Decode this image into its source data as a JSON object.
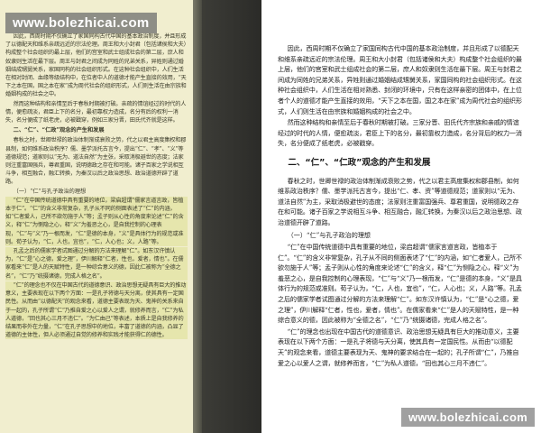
{
  "watermark": {
    "top": "www.bolezhicai.com",
    "bottom": "www.bolezhicai.com"
  },
  "left_page": {
    "p1": "上是田野中的。",
    "p1_text": "因此，西周时期不仅确立了家国同构古代中国的基本政治制度，并且形成了以德配天和维系亲疏远近的宗法伦理。周王和大小封君（包括诸侯和大夫）构成整个社会组织的最上层，他们的宫室和武士组成社会的第二层，庶人和奴隶则生活在最下层。周王与封君之间成为同姓的兄弟关系，异姓则通过婚姻结成甥舅关系，家国同构的社会组织形式。在这种社会组织中，人们生活在相对封闭、血缘等级结构中，在位者中人的道德才能产生直接的效用，“天下之本在国，国之本在家”成为周代社会的组织形式，人们则生活在由宗族和婚姻构成的社会之中。",
    "p2": "然而这种结构和亲情至后于春秋时期被打破。亲疏的情谊经过的时代的人情，便愈疏淡，君臣上下的名分，最初靠权力造成，名分有后的权利一消失，名分便成了纸老虎，必被戳穿，例如三家分晋，田氏代齐就是这样。",
    "section": "二、“仁”、“仁政”观念的产生和发展",
    "p3": "春秋之时，世卿世禄的政治体制渐成衰败之势，代之以君主高度集权和郡县制，如何维系政治秩序？儒、墨学派托古言今，提出“仁”、“孝”、“义”等道德规范；道家则以“无为、道法自然”为主张，采取消极避世的态度；法家则注重富国强兵，尊君重国，说明德政之存在和可能。诸子百家之学说相互斗争，相互融合，融汇转换，为秦汉以后之政治思想、政治道德开辟了道路。",
    "subsec": "（一）“仁”与孔子政治的理想",
    "p4": "“仁”在中国传统道德中具有重要的地位，梁启超谓“儒家言道言政，皆植本于仁”。“仁”的含义非常复杂，孔子从不同的侧面表述了“仁”的内涵，如“仁者爱人，己所不欲勿施于人”等；孟子则从心性的角度来论述“仁”的含义，释“仁”为恻隐之心，释“义”为羞恶之心，是自我控制的心理表现，“仁”与“义”乃一根而发，“仁”是德的本身，“义”是具体行为的规范或准则。荀子认为，“仁，人也，宜也”，“仁，人心也；义，人路”等。",
    "p5": "孔孟之后的儒家学者试图通过分解的方法来理解“仁”。如东汉许慎认为，“仁”是“心之德，爱之理”，伊川解释“仁者，性也，爱者，情也”。在儒家看来“仁”是人的天赋特性，是一种综合意义的德，因此仁被称为“全德之名”，“仁”乃“统摄诸德，完成人格之名”。",
    "p6": "“仁”的理念也不仅在中国古代的道德意识、政治思想无疑具有巨大的推动意义，主要表现在以下两个方面：一是孔子将德与天分离，使其具有一定国民性。从而由“以德配天”的观念来看，道德主要表现为天、鬼神的关系来自于一起的，孔子所谓“仁”乃推自爱之心以爱人之谓，就修养而言，“仁”为私人道德，“回也其心三月不违仁”。“为仁由己”等表述，本质上是自我修养的结果而非外在力量，“仁”在孔子思想中的地位，丰富了道德的内涵，凸显了道德的主体性，但人必须通过自觉的修养和实践才能获得仁的德性。"
  },
  "right_page": {
    "p1": "因此，西周时期不仅确立了家国同构古代中国的基本政治制度，并且形成了以德配天和维系亲疏远近的宗法伦理。周王和大小封君（包括诸侯和大夫）构成整个社会组织的最上层，他们的宫室和武士组成社会的第二层，庶人和奴隶则生活在最下层。周王与封君之间成为同姓的兄弟关系，异姓则通过婚姻结成甥舅关系，家国同构的社会组织形式。在这种社会组织中，人们生活在相对熟悉、封闭的环境中，只有在这样亲密的团体中，在上位者个人的道德才能产生直接的效用，“天下之本在国，国之本在家”成为周代社会的组织形式，人们则生活在由宗族和婚姻构成的社会之中。",
    "p2": "然而这种结构和亲情至后于春秋时期被打破。三家分晋、田氏代齐宗族和亲戚的情谊经过的时代的人情，便愈疏淡，君臣上下的名分，最初靠权力造成，名分背后的权力一消失，名分便成了纸老虎，必被戳穿。",
    "section": "二、“仁”、“仁政”观念的产生和发展",
    "p3": "春秋之时，世卿世禄的政治体制渐成衰败之势，代之以君主高度集权和郡县制，如何维系政治秩序？儒、墨学派托古言今，提出“仁、孝、资”等道德规范；道家则以“无为、道法自然”为主，采取消极避世的态度；法家则注重富国强兵、尊君重国，说明德政之存在和可能。诸子百家之学说相互斗争、相互融合，融汇转换，为秦汉以后之政治思想、政治道德开辟了道路。",
    "subsec": "（一）“仁”与孔子政治的理想",
    "p4": "“仁”在中国传统道德中具有重要的地位，梁启超谓“儒家言道言政，皆植本于仁”。“仁”的含义非常复杂，孔子从不同的侧面表述了“仁”的内涵，如“仁者爱人，己所不欲勿施于人”等；孟子则从心性的角度来论述“仁”的含义，释“仁”为恻隐之心，释“义”为羞恶之心，是自我控制的心理表现，“仁”与“义”乃一根而发，“仁”是德的本身，“义”是具体行为的规范或准则。荀子认为，“仁，人也，宜也”，“仁，人心也；义，人路”等。孔孟之后的儒家学者试图通过分解的方法来理解“仁”。如东汉许慎认为，“仁”是“心之德，爱之理”，伊川解释“仁者，性也，爱者，情也”。在儒家看来“仁”是人的天赋特性，是一种综合意义的德，因此被称为“全德之名”，“仁”乃“统摄诸德，完成人格之名”。",
    "p5": "“仁”的理念也出现在中国古代的道德意识、政治思想无疑具有巨大的推动意义，主要表现在以下两个方面：一是孔子将德与天分离，使其具有一定国民性。从而由“以德配天”的观念来看，道德主要表现为天、鬼神的要求结合在一起的；孔子所谓“仁”，乃推自爱之心以爱人之谓，就修养而言，“仁”为私人道德，“回也其心三月不违仁”。"
  }
}
